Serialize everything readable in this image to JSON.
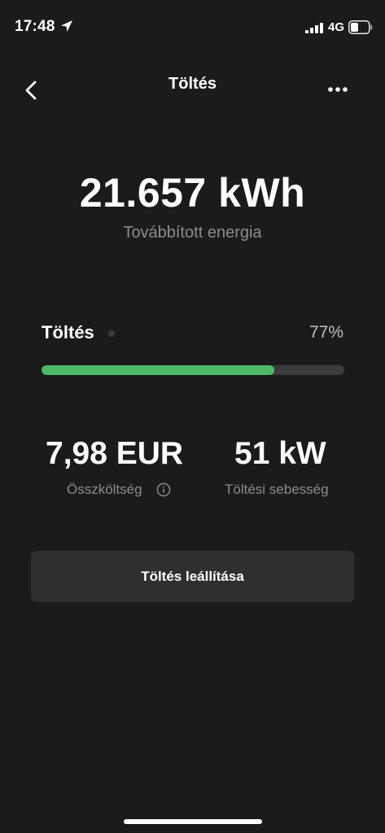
{
  "status_bar": {
    "time": "17:48",
    "network": "4G",
    "icons": [
      "location-arrow-icon",
      "cellular-signal-icon",
      "battery-icon"
    ]
  },
  "nav": {
    "title": "Töltés",
    "icons": [
      "chevron-left-icon",
      "more-horizontal-icon"
    ]
  },
  "energy": {
    "value": "21.657 kWh",
    "label": "Továbbított energia"
  },
  "charging": {
    "label": "Töltés",
    "percent_text": "77%",
    "progress_percent": 77
  },
  "stats": {
    "cost_value": "7,98 EUR",
    "cost_label": "Összköltség",
    "speed_value": "51 kW",
    "speed_label": "Töltési sebesség"
  },
  "actions": {
    "stop_label": "Töltés leállítása"
  },
  "colors": {
    "background": "#1a1b1a",
    "progress_fill": "#4cba66",
    "progress_track": "#3a3b3a",
    "button_bg": "#2f2f2f",
    "muted_text": "#8c8c8c"
  }
}
